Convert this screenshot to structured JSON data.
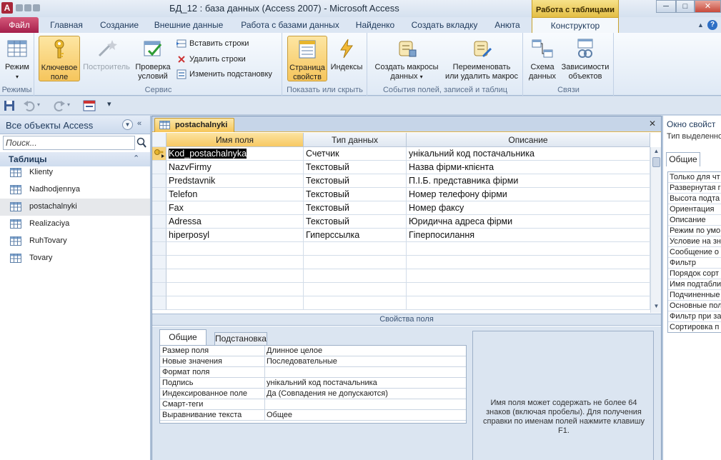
{
  "window": {
    "app_icon_letter": "A",
    "title": "БД_12 : база данных (Access 2007)  -  Microsoft Access",
    "context_header": "Работа с таблицами",
    "min": "─",
    "max": "□",
    "close": "✕"
  },
  "tabs": [
    "Файл",
    "Главная",
    "Создание",
    "Внешние данные",
    "Работа с базами данных",
    "Найденко",
    "Создать вкладку",
    "Анюта",
    "Конструктор"
  ],
  "ribbon": {
    "groups": {
      "modes": "Режимы",
      "service": "Сервис",
      "show_hide": "Показать или скрыть",
      "events": "События полей, записей и таблиц",
      "relations": "Связи"
    },
    "buttons": {
      "mode_line1": "Режим",
      "key_line1": "Ключевое",
      "key_line2": "поле",
      "builder": "Построитель",
      "validation_line1": "Проверка",
      "validation_line2": "условий",
      "insert_rows": "Вставить строки",
      "delete_rows": "Удалить строки",
      "modify_lookup": "Изменить подстановку",
      "prop_sheet_line1": "Страница",
      "prop_sheet_line2": "свойств",
      "indexes": "Индексы",
      "create_macros_line1": "Создать макросы",
      "create_macros_line2": "данных",
      "rename_macro_line1": "Переименовать",
      "rename_macro_line2": "или удалить макрос",
      "schema_line1": "Схема",
      "schema_line2": "данных",
      "deps_line1": "Зависимости",
      "deps_line2": "объектов"
    }
  },
  "nav": {
    "title": "Все объекты Access",
    "search_placeholder": "Поиск...",
    "group_title": "Таблицы",
    "items": [
      "Klienty",
      "Nadhodjennya",
      "postachalnyki",
      "Realizaciya",
      "RuhTovary",
      "Tovary"
    ]
  },
  "document": {
    "tab_title": "postachalnyki",
    "columns": [
      "Имя поля",
      "Тип данных",
      "Описание"
    ],
    "rows": [
      {
        "name": "Kod_postachalnyka",
        "type": "Счетчик",
        "desc": "унікальний код постачальника"
      },
      {
        "name": "NazvFirmy",
        "type": "Текстовый",
        "desc": "Назва фірми-кпієнта"
      },
      {
        "name": "Predstavnik",
        "type": "Текстовый",
        "desc": "П.І.Б. представника фірми"
      },
      {
        "name": "Telefon",
        "type": "Текстовый",
        "desc": "Номер телефону фірми"
      },
      {
        "name": "Fax",
        "type": "Текстовый",
        "desc": "Номер факсу"
      },
      {
        "name": "Adressa",
        "type": "Текстовый",
        "desc": "Юридична адреса фірми"
      },
      {
        "name": "hiperposyl",
        "type": "Гиперссылка",
        "desc": "Гіперпосилання"
      }
    ]
  },
  "field_props": {
    "header": "Свойства поля",
    "tab_general": "Общие",
    "tab_lookup": "Подстановка",
    "rows": [
      {
        "k": "Размер поля",
        "v": "Длинное целое"
      },
      {
        "k": "Новые значения",
        "v": "Последовательные"
      },
      {
        "k": "Формат поля",
        "v": ""
      },
      {
        "k": "Подпись",
        "v": "унікальний код постачальника"
      },
      {
        "k": "Индексированное поле",
        "v": "Да (Совпадения не допускаются)"
      },
      {
        "k": "Смарт-теги",
        "v": ""
      },
      {
        "k": "Выравнивание текста",
        "v": "Общее"
      }
    ],
    "help": "Имя поля может содержать не более 64 знаков (включая пробелы). Для получения справки по именам полей нажмите клавишу F1."
  },
  "property_sheet": {
    "title": "Окно свойст",
    "subtitle": "Тип выделенно",
    "tab": "Общие",
    "rows": [
      "Только для чт",
      "Развернутая г",
      "Высота подта",
      "Ориентация",
      "Описание",
      "Режим по умо",
      "Условие на зн",
      "Сообщение о",
      "Фильтр",
      "Порядок сорт",
      "Имя подтабли",
      "Подчиненные",
      "Основные пол",
      "Фильтр при за",
      "Сортировка п"
    ]
  },
  "colors": {
    "accent": "#f6c55c",
    "file_tab": "#a51f4b",
    "context": "#e3be45"
  }
}
